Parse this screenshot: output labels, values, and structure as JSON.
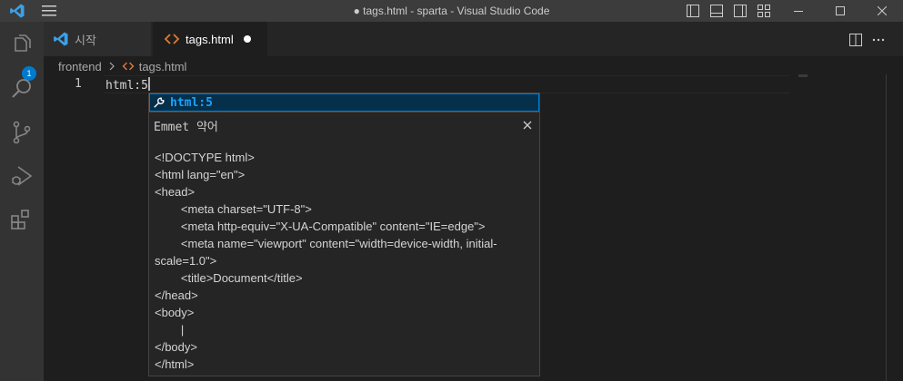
{
  "window": {
    "title": "● tags.html - sparta - Visual Studio Code"
  },
  "activity": {
    "explorer_badge": "1"
  },
  "tabs": [
    {
      "label": "시작"
    },
    {
      "label": "tags.html"
    }
  ],
  "breadcrumb": {
    "folder": "frontend",
    "file": "tags.html"
  },
  "editor": {
    "line_number": "1",
    "line_text": "html:5"
  },
  "suggest": {
    "label": "html:5"
  },
  "details": {
    "title": "Emmet 약어",
    "lines": [
      "<!DOCTYPE html>",
      "<html lang=\"en\">",
      "<head>",
      "        <meta charset=\"UTF-8\">",
      "        <meta http-equiv=\"X-UA-Compatible\" content=\"IE=edge\">",
      "        <meta name=\"viewport\" content=\"width=device-width, initial-",
      "scale=1.0\">",
      "        <title>Document</title>",
      "</head>",
      "<body>",
      "        |",
      "</body>",
      "</html>"
    ]
  },
  "colors": {
    "accent": "#007acc",
    "suggest_highlight": "#18a3ff",
    "html_icon": "#e37933",
    "vscode_logo": "#3ca0e8"
  }
}
